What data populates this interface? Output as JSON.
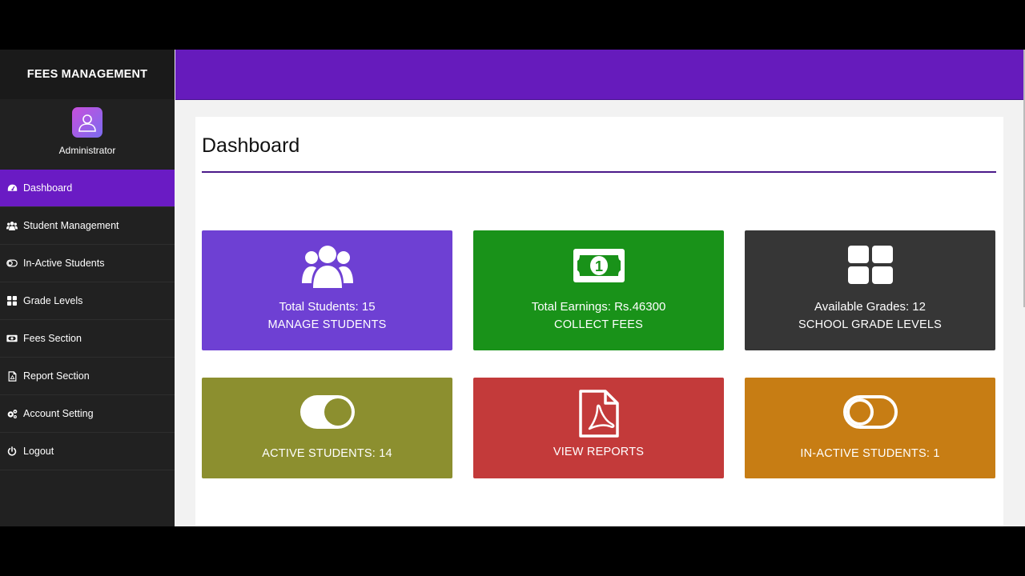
{
  "sidebar": {
    "brand": "FEES MANAGEMENT",
    "user": "Administrator",
    "items": [
      {
        "label": "Dashboard",
        "icon": "dashboard-icon",
        "active": true
      },
      {
        "label": "Student Management",
        "icon": "users-icon"
      },
      {
        "label": "In-Active Students",
        "icon": "toggle-off-icon"
      },
      {
        "label": "Grade Levels",
        "icon": "grid-icon"
      },
      {
        "label": "Fees Section",
        "icon": "money-bill-icon"
      },
      {
        "label": "Report Section",
        "icon": "pdf-file-icon"
      },
      {
        "label": "Account Setting",
        "icon": "gears-icon"
      },
      {
        "label": "Logout",
        "icon": "power-icon"
      }
    ]
  },
  "main": {
    "title": "Dashboard",
    "cards": [
      {
        "line1": "Total Students: 15",
        "line2": "MANAGE STUDENTS",
        "color": "#6e40d3",
        "icon": "users-icon"
      },
      {
        "line1": "Total Earnings: Rs.46300",
        "line2": "COLLECT FEES",
        "color": "#199219",
        "icon": "money-bill-icon"
      },
      {
        "line1": "Available Grades: 12",
        "line2": "SCHOOL GRADE LEVELS",
        "color": "#363636",
        "icon": "grid-icon"
      },
      {
        "line2": "ACTIVE STUDENTS: 14",
        "color": "#8c8f2f",
        "icon": "toggle-on-icon"
      },
      {
        "line2": "VIEW REPORTS",
        "color": "#c33a3a",
        "icon": "pdf-file-icon"
      },
      {
        "line2": "IN-ACTIVE STUDENTS: 1",
        "color": "#c77d14",
        "icon": "toggle-off-icon"
      }
    ]
  },
  "colors": {
    "accent": "#661bbc",
    "sidebar_bg": "#212121"
  }
}
